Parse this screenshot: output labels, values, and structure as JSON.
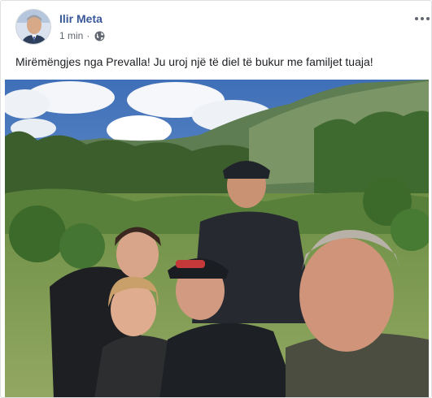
{
  "post": {
    "author_name": "Ilir Meta",
    "timestamp": "1 min",
    "separator": "·",
    "privacy_icon": "globe-icon",
    "more_icon": "more-horizontal-icon",
    "text": "Mirëmëngjes nga Prevalla! Ju uroj një të diel të bukur me familjet tuaja!"
  },
  "colors": {
    "author_link": "#385898",
    "meta_text": "#616770",
    "body_text": "#1c1e21",
    "card_border": "#dddfe2"
  }
}
